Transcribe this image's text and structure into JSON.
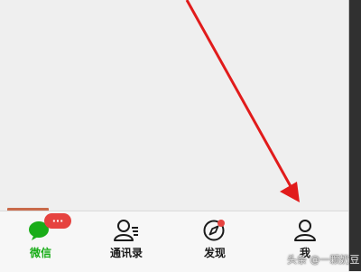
{
  "tabbar": {
    "tabs": [
      {
        "label": "微信",
        "icon": "chat-bubble-icon",
        "active": true,
        "badge": "···"
      },
      {
        "label": "通讯录",
        "icon": "contacts-icon",
        "active": false
      },
      {
        "label": "发现",
        "icon": "compass-icon",
        "active": false,
        "red_dot": true
      },
      {
        "label": "我",
        "icon": "person-icon",
        "active": false
      }
    ]
  },
  "annotation": {
    "arrow_color": "#e11b1b"
  },
  "colors": {
    "active": "#1aad19",
    "badge": "#e64340"
  },
  "watermark": "头条 @一颗奶豆"
}
